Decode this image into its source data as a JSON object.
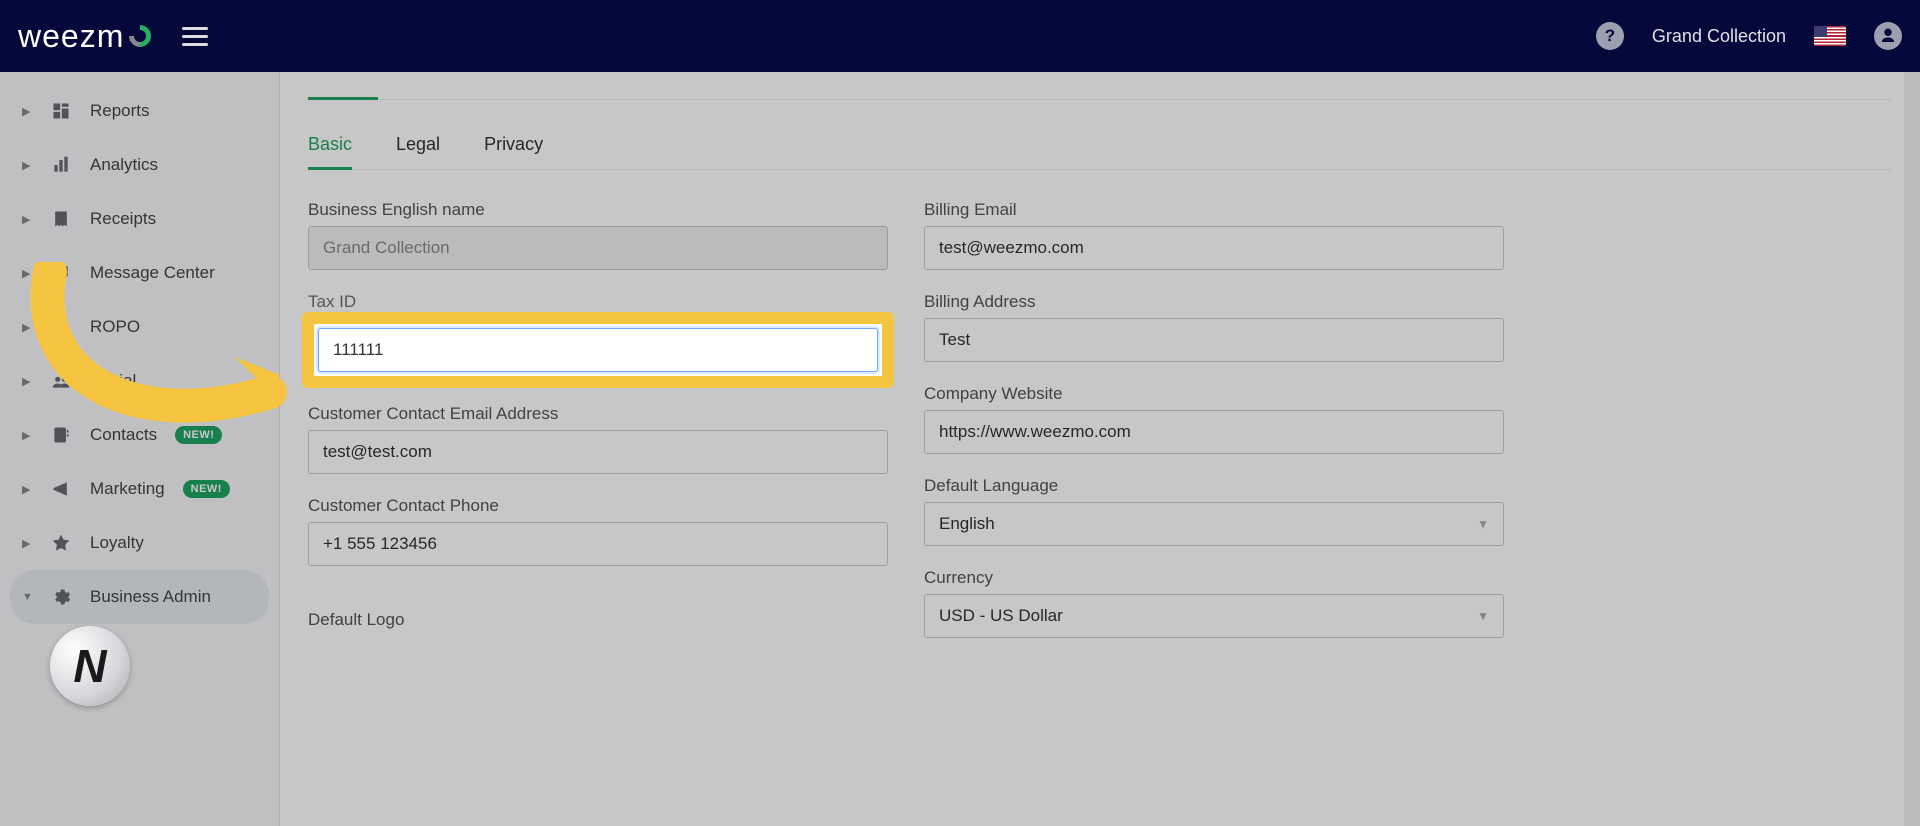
{
  "app": {
    "logo_text_prefix": "weezm",
    "company": "Grand Collection"
  },
  "sidebar": {
    "items": [
      {
        "label": "Reports"
      },
      {
        "label": "Analytics"
      },
      {
        "label": "Receipts"
      },
      {
        "label": "Message Center"
      },
      {
        "label": "ROPO"
      },
      {
        "label": "Social"
      },
      {
        "label": "Contacts",
        "badge": "NEW!"
      },
      {
        "label": "Marketing",
        "badge": "NEW!"
      },
      {
        "label": "Loyalty"
      },
      {
        "label": "Business Admin"
      }
    ]
  },
  "subtabs": [
    {
      "label": "Basic",
      "active": true
    },
    {
      "label": "Legal"
    },
    {
      "label": "Privacy"
    }
  ],
  "form": {
    "left": {
      "business_name": {
        "label": "Business English name",
        "value": "Grand Collection"
      },
      "tax_id": {
        "label": "Tax ID",
        "value": "111111"
      },
      "contact_email": {
        "label": "Customer Contact Email Address",
        "value": "test@test.com"
      },
      "contact_phone": {
        "label": "Customer Contact Phone",
        "value": "+1 555 123456"
      }
    },
    "right": {
      "billing_email": {
        "label": "Billing Email",
        "value": "test@weezmo.com"
      },
      "billing_address": {
        "label": "Billing Address",
        "value": "Test"
      },
      "website": {
        "label": "Company Website",
        "value": "https://www.weezmo.com"
      },
      "language": {
        "label": "Default Language",
        "value": "English"
      },
      "currency": {
        "label": "Currency",
        "value": "USD - US Dollar"
      }
    },
    "logo_label": "Default Logo"
  }
}
